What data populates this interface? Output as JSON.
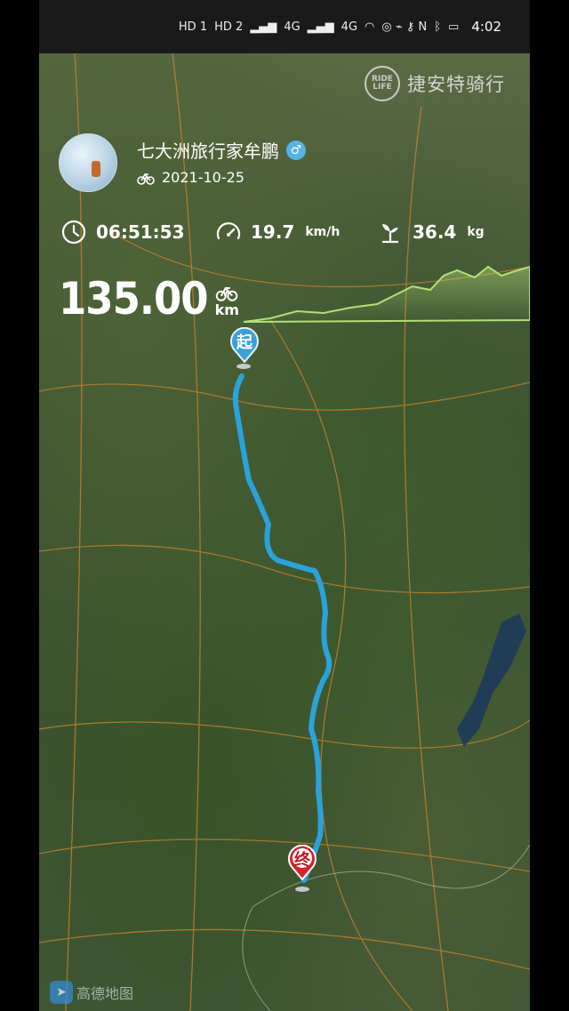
{
  "status_bar": {
    "network_labels": [
      "HD 1",
      "HD 2",
      "4G",
      "4G"
    ],
    "time": "4:02"
  },
  "brand": {
    "logo_text": "RIDE LIFE",
    "name": "捷安特骑行"
  },
  "profile": {
    "username": "七大洲旅行家牟鹏",
    "gender_symbol": "♂",
    "date": "2021-10-25"
  },
  "stats": {
    "duration": "06:51:53",
    "speed": "19.7",
    "speed_unit": "km/h",
    "carbon": "36.4",
    "carbon_unit": "kg"
  },
  "distance": {
    "value": "135.00",
    "unit": "km"
  },
  "markers": {
    "start_label": "起",
    "end_label": "终"
  },
  "map_provider": "高德地图",
  "colors": {
    "route": "#2aa3dc",
    "start_pin": "#3d9fd8",
    "end_pin": "#d3262c",
    "elevation": "#b4e07a"
  },
  "icons": [
    "clock-icon",
    "speedometer-icon",
    "sprout-icon",
    "bicycle-icon"
  ]
}
